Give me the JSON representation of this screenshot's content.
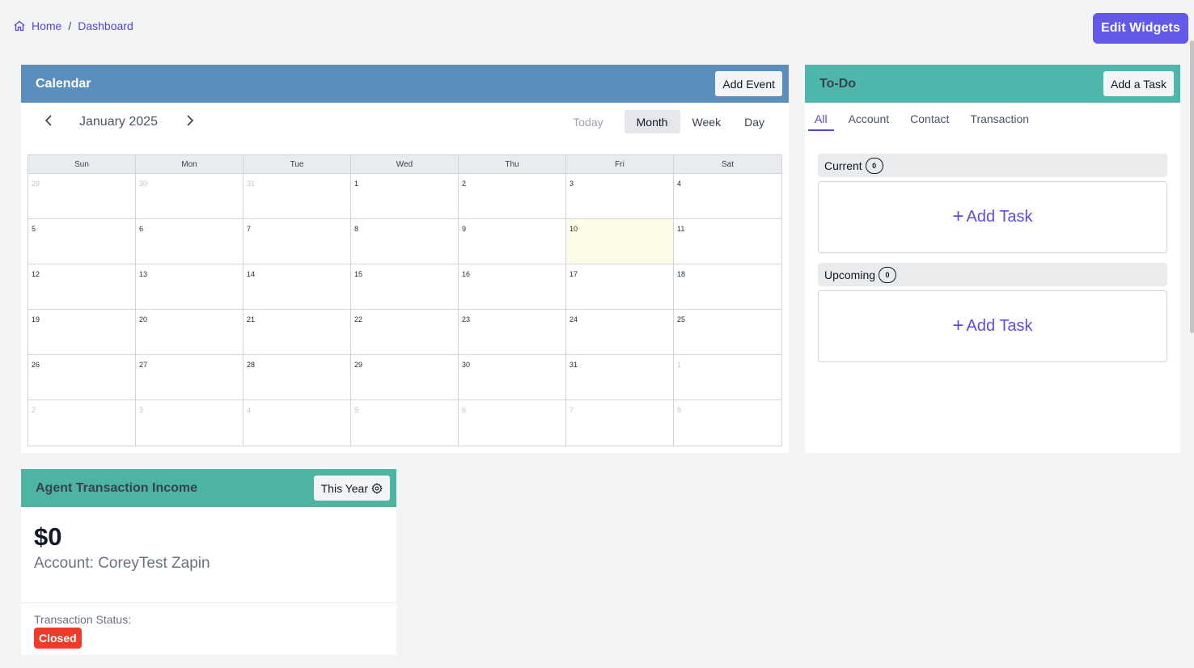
{
  "breadcrumb": {
    "home": "Home",
    "separator": "/",
    "current": "Dashboard"
  },
  "header": {
    "edit_widgets_label": "Edit Widgets",
    "accent": "#6258ea"
  },
  "calendar": {
    "title": "Calendar",
    "add_event_label": "Add Event",
    "month_label": "January 2025",
    "views": {
      "today": "Today",
      "month": "Month",
      "week": "Week",
      "day": "Day"
    },
    "active_view": "Month",
    "days_of_week": [
      "Sun",
      "Mon",
      "Tue",
      "Wed",
      "Thu",
      "Fri",
      "Sat"
    ],
    "cells": [
      [
        "29",
        "other"
      ],
      [
        "30",
        "other"
      ],
      [
        "31",
        "other"
      ],
      [
        "1",
        ""
      ],
      [
        "2",
        ""
      ],
      [
        "3",
        ""
      ],
      [
        "4",
        ""
      ],
      [
        "5",
        ""
      ],
      [
        "6",
        ""
      ],
      [
        "7",
        ""
      ],
      [
        "8",
        ""
      ],
      [
        "9",
        ""
      ],
      [
        "10",
        "today"
      ],
      [
        "11",
        ""
      ],
      [
        "12",
        ""
      ],
      [
        "13",
        ""
      ],
      [
        "14",
        ""
      ],
      [
        "15",
        ""
      ],
      [
        "16",
        ""
      ],
      [
        "17",
        ""
      ],
      [
        "18",
        ""
      ],
      [
        "19",
        ""
      ],
      [
        "20",
        ""
      ],
      [
        "21",
        ""
      ],
      [
        "22",
        ""
      ],
      [
        "23",
        ""
      ],
      [
        "24",
        ""
      ],
      [
        "25",
        ""
      ],
      [
        "26",
        ""
      ],
      [
        "27",
        ""
      ],
      [
        "28",
        ""
      ],
      [
        "29",
        ""
      ],
      [
        "30",
        ""
      ],
      [
        "31",
        ""
      ],
      [
        "1",
        "other"
      ],
      [
        "2",
        "other"
      ],
      [
        "3",
        "other"
      ],
      [
        "4",
        "other"
      ],
      [
        "5",
        "other"
      ],
      [
        "6",
        "other"
      ],
      [
        "7",
        "other"
      ],
      [
        "8",
        "other"
      ]
    ],
    "header_color": "#5a8fbd"
  },
  "todo": {
    "title": "To-Do",
    "add_task_label": "Add a Task",
    "tabs": [
      "All",
      "Account",
      "Contact",
      "Transaction"
    ],
    "active_tab": "All",
    "groups": [
      {
        "label": "Current",
        "count": "0",
        "add_label": "Add Task"
      },
      {
        "label": "Upcoming",
        "count": "0",
        "add_label": "Add Task"
      }
    ],
    "header_color": "#4eb7ab"
  },
  "income": {
    "title": "Agent Transaction Income",
    "period_label": "This Year",
    "amount": "$0",
    "account": "Account: CoreyTest Zapin",
    "status_label": "Transaction Status:",
    "status_value": "Closed",
    "status_color": "#ef3b2a",
    "header_color": "#4fb3a1"
  }
}
